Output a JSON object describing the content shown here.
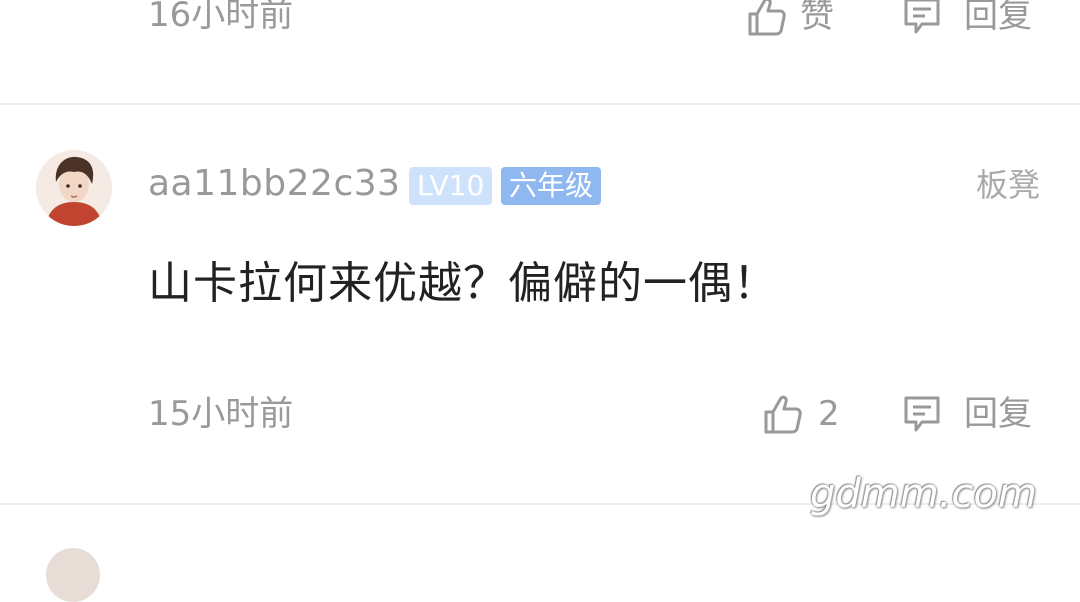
{
  "previous_comment": {
    "time": "16小时前",
    "like_label": "赞",
    "reply_label": "回复"
  },
  "comment": {
    "username": "aa11bb22c33",
    "level_badge": "LV10",
    "grade_badge": "六年级",
    "floor_label": "板凳",
    "content": "山卡拉何来优越？偏僻的一偶！",
    "time": "15小时前",
    "like_count": "2",
    "reply_label": "回复"
  },
  "watermark": "gdmm.com",
  "colors": {
    "muted_text": "#999999",
    "badge_level_bg": "#cfe2fb",
    "badge_grade_bg": "#8fb8f0",
    "divider": "#eeeeee"
  }
}
